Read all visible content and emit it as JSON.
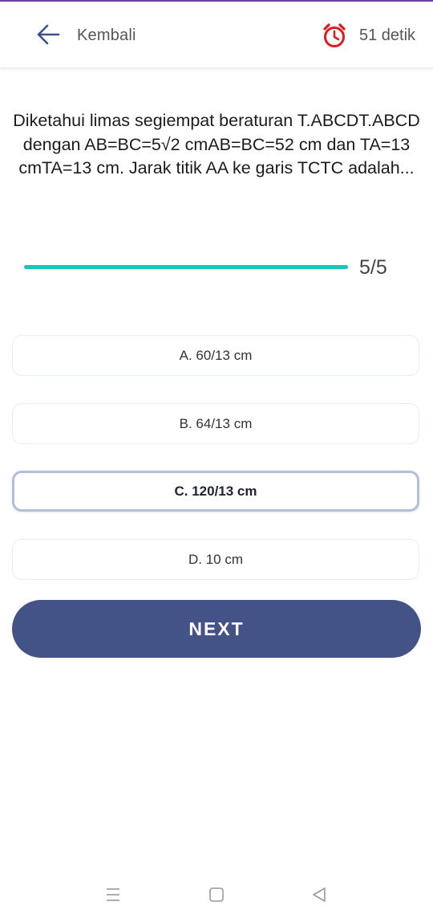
{
  "header": {
    "back_label": "Kembali",
    "timer_text": "51 detik",
    "back_icon": "arrow-left-icon",
    "timer_icon": "alarm-clock-icon",
    "alarm_color": "#e0191f",
    "back_icon_color": "#3d4f8f"
  },
  "question": {
    "text": "Diketahui limas segiempat beraturan T.ABCDT.ABCD dengan AB=BC=5√2 cmAB=BC=52 cm dan TA=13 cmTA=13 cm. Jarak titik AA ke garis TCTC adalah..."
  },
  "progress": {
    "label": "5/5",
    "fraction": 1.0,
    "color": "#14c8b8"
  },
  "options": [
    {
      "label": "A. 60/13 cm",
      "selected": false
    },
    {
      "label": "B. 64/13 cm",
      "selected": false
    },
    {
      "label": "C. 120/13 cm",
      "selected": true
    },
    {
      "label": "D. 10 cm",
      "selected": false
    }
  ],
  "next_button": {
    "label": "NEXT",
    "color": "#435287"
  },
  "navbar": {
    "icons": [
      "menu-icon",
      "home-square-icon",
      "back-triangle-icon"
    ]
  }
}
